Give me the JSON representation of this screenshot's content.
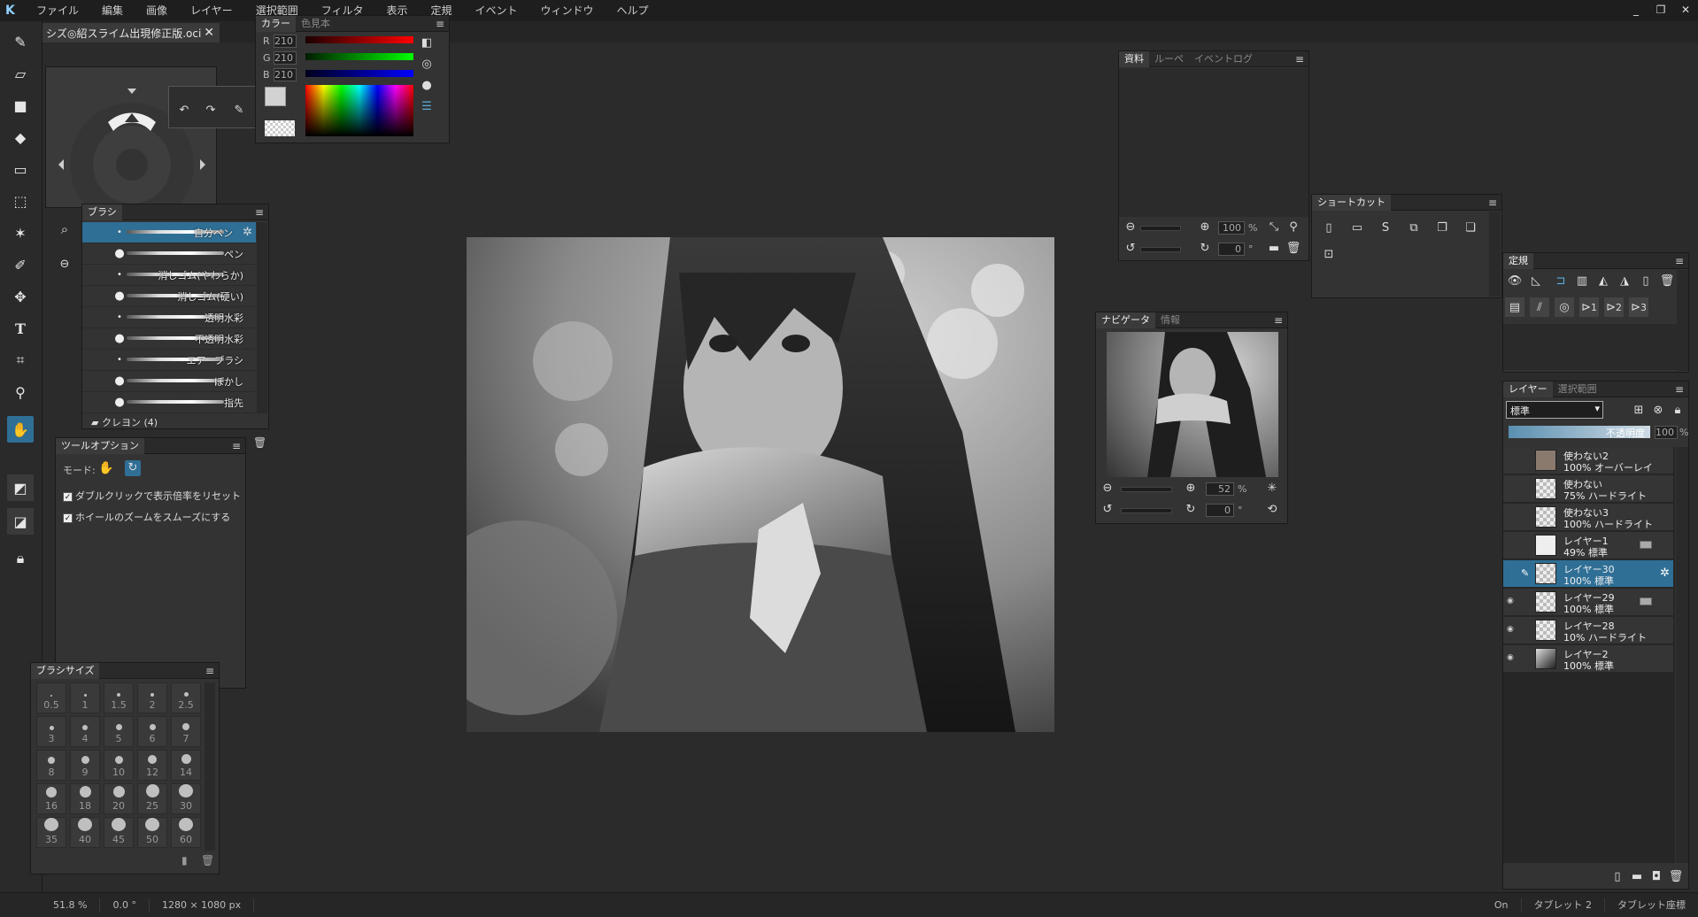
{
  "menubar": {
    "logo": "K",
    "items": [
      "ファイル",
      "編集",
      "画像",
      "レイヤー",
      "選択範囲",
      "フィルタ",
      "表示",
      "定規",
      "イベント",
      "ウィンドウ",
      "ヘルプ"
    ],
    "min": "_",
    "restore": "❐",
    "close": "✕"
  },
  "document_tab": {
    "title": "シズ◎紹スライム出現修正版.oci",
    "close": "✕"
  },
  "color_panel": {
    "tabs": [
      "カラー",
      "色見本"
    ],
    "r_label": "R",
    "r": "210",
    "g_label": "G",
    "g": "210",
    "b_label": "B",
    "b": "210",
    "color_hex": "#d2d2d2"
  },
  "brush_panel": {
    "title": "ブラシ",
    "items": [
      "自分ペン",
      "ペン",
      "消しゴム(やわらか)",
      "消しゴム(硬い)",
      "透明水彩",
      "不透明水彩",
      "エアーブラシ",
      "ぼかし",
      "指先"
    ],
    "folder": "クレヨン (4)"
  },
  "tool_options": {
    "title": "ツールオプション",
    "mode_label": "モード:",
    "opt1": "ダブルクリックで表示倍率をリセット",
    "opt2": "ホイールのズームをスムーズにする"
  },
  "brush_size": {
    "title": "ブラシサイズ",
    "sizes": [
      "0.5",
      "1",
      "1.5",
      "2",
      "2.5",
      "3",
      "4",
      "5",
      "6",
      "7",
      "8",
      "9",
      "10",
      "12",
      "14",
      "16",
      "18",
      "20",
      "25",
      "30",
      "35",
      "40",
      "45",
      "50",
      "60"
    ]
  },
  "material_panel": {
    "tabs": [
      "資料",
      "ルーペ",
      "イベントログ"
    ],
    "zoom": "100",
    "zoom_unit": "%",
    "angle": "0",
    "angle_unit": "°"
  },
  "shortcut_panel": {
    "title": "ショートカット"
  },
  "navigator_panel": {
    "tabs": [
      "ナビゲータ",
      "情報"
    ],
    "zoom": "52",
    "zoom_unit": "%",
    "angle": "0",
    "angle_unit": "°"
  },
  "ruler_panel": {
    "title": "定規",
    "nums": [
      "1",
      "2",
      "3"
    ]
  },
  "layer_panel": {
    "tabs": [
      "レイヤー",
      "選択範囲"
    ],
    "blend_mode": "標準",
    "opacity_label": "不透明度",
    "opacity": "100",
    "opacity_unit": "%",
    "layers": [
      {
        "name": "使わない2",
        "mode": "100% オーバーレイ"
      },
      {
        "name": "使わない",
        "mode": "75% ハードライト"
      },
      {
        "name": "使わない3",
        "mode": "100% ハードライト"
      },
      {
        "name": "レイヤー1",
        "mode": "49% 標準"
      },
      {
        "name": "レイヤー30",
        "mode": "100% 標準"
      },
      {
        "name": "レイヤー29",
        "mode": "100% 標準"
      },
      {
        "name": "レイヤー28",
        "mode": "10% ハードライト"
      },
      {
        "name": "レイヤー2",
        "mode": "100% 標準"
      }
    ]
  },
  "statusbar": {
    "zoom": "51.8 %",
    "angle": "0.0 °",
    "size": "1280 × 1080 px",
    "on": "On",
    "tablet": "タブレット 2",
    "tablet_coords": "タブレット座標"
  }
}
